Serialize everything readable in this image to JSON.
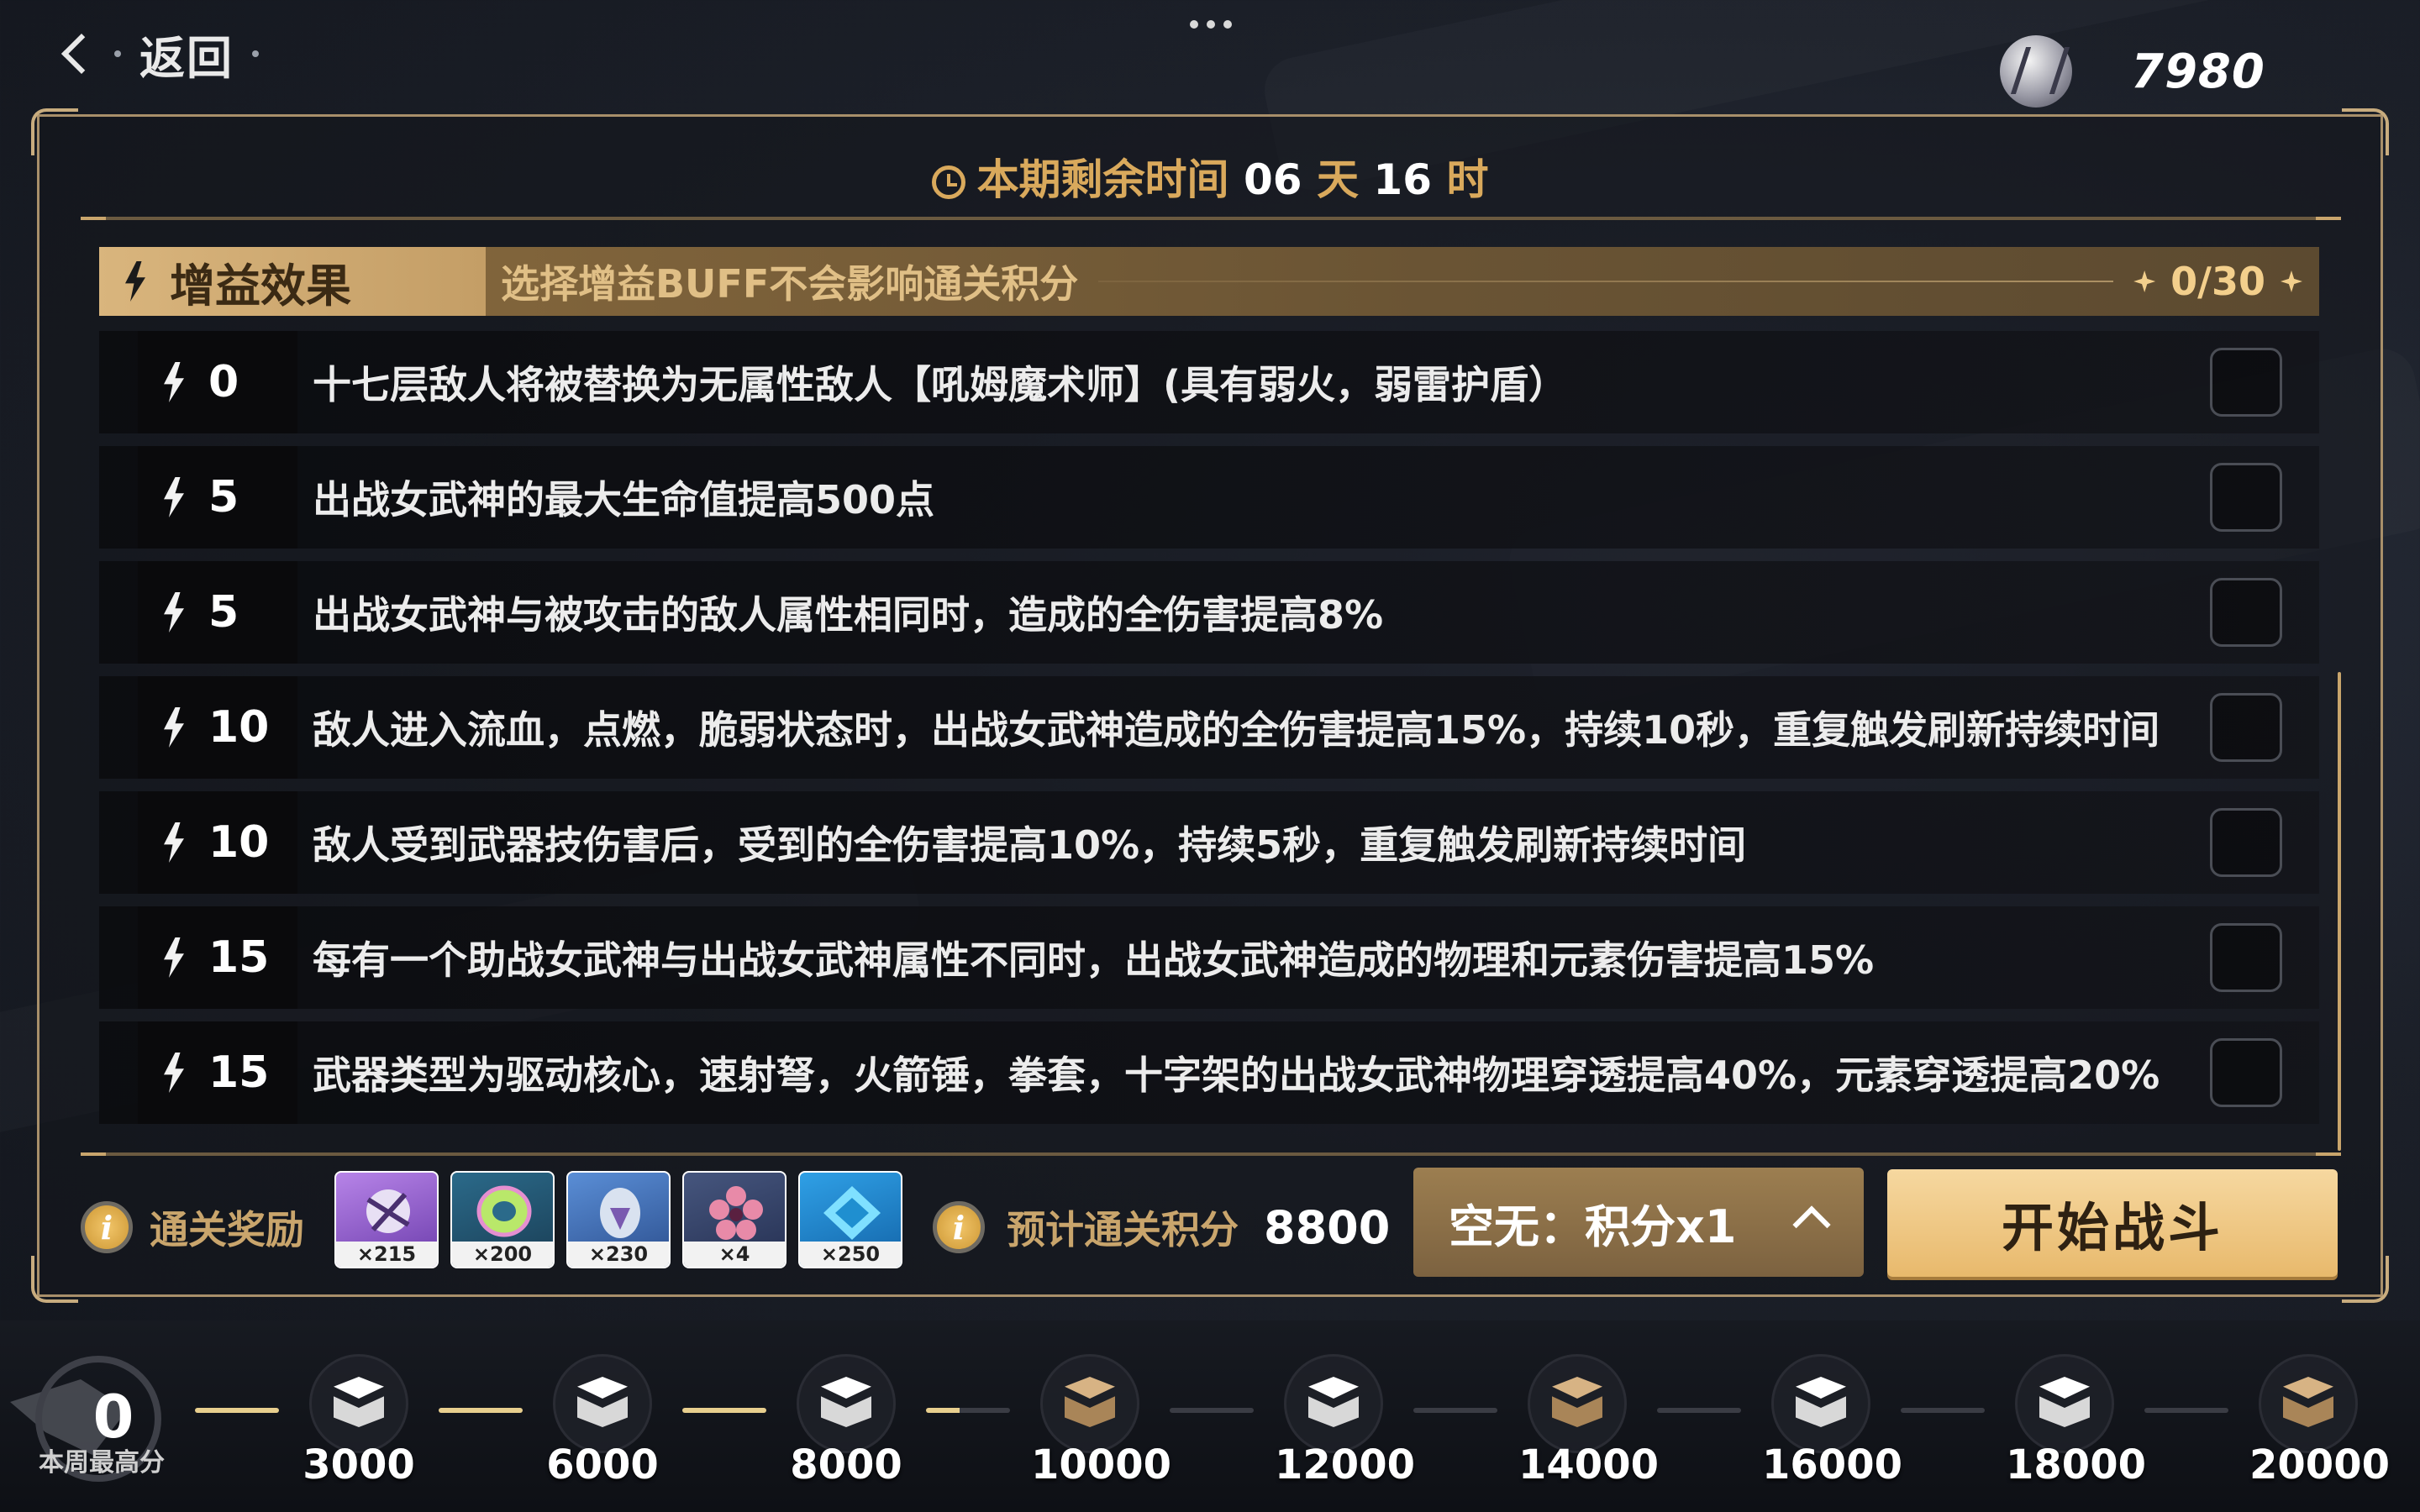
{
  "topbar": {
    "back_label": "返回",
    "currency_value": "7980"
  },
  "timer": {
    "label": "本期剩余时间",
    "days": "06",
    "days_unit": "天",
    "hours": "16",
    "hours_unit": "时"
  },
  "buff_header": {
    "title": "增益效果",
    "note": "选择增益BUFF不会影响通关积分",
    "count": "0/30"
  },
  "buffs": [
    {
      "cost": "0",
      "desc": "十七层敌人将被替换为无属性敌人【吼姆魔术师】(具有弱火，弱雷护盾）",
      "checked": false
    },
    {
      "cost": "5",
      "desc": "出战女武神的最大生命值提高500点",
      "checked": false
    },
    {
      "cost": "5",
      "desc": "出战女武神与被攻击的敌人属性相同时，造成的全伤害提高8%",
      "checked": false
    },
    {
      "cost": "10",
      "desc": "敌人进入流血，点燃，脆弱状态时，出战女武神造成的全伤害提高15%，持续10秒，重复触发刷新持续时间",
      "checked": false
    },
    {
      "cost": "10",
      "desc": "敌人受到武器技伤害后，受到的全伤害提高10%，持续5秒，重复触发刷新持续时间",
      "checked": false
    },
    {
      "cost": "15",
      "desc": "每有一个助战女武神与出战女武神属性不同时，出战女武神造成的物理和元素伤害提高15%",
      "checked": false
    },
    {
      "cost": "15",
      "desc": "武器类型为驱动核心，速射弩，火箭锤，拳套，十字架的出战女武神物理穿透提高40%，元素穿透提高20%",
      "checked": false
    }
  ],
  "rewards": {
    "label": "通关奖励",
    "items": [
      {
        "icon": "valkyrie-fragment-icon",
        "qty": "×215"
      },
      {
        "icon": "coin-icon",
        "qty": "×200"
      },
      {
        "icon": "egg-crystal-icon",
        "qty": "×230"
      },
      {
        "icon": "pink-flower-icon",
        "qty": "×4"
      },
      {
        "icon": "blue-crystal-icon",
        "qty": "×250"
      }
    ]
  },
  "score": {
    "label": "预计通关积分",
    "value": "8800"
  },
  "mode": {
    "label": "空无：积分x1"
  },
  "start_button": "开始战斗",
  "progress": {
    "best_score": "0",
    "best_label": "本周最高分",
    "milestones": [
      {
        "value": "3000",
        "color": "white"
      },
      {
        "value": "6000",
        "color": "white"
      },
      {
        "value": "8000",
        "color": "white"
      },
      {
        "value": "10000",
        "color": "brown"
      },
      {
        "value": "12000",
        "color": "white"
      },
      {
        "value": "14000",
        "color": "brown"
      },
      {
        "value": "16000",
        "color": "white"
      },
      {
        "value": "18000",
        "color": "white"
      },
      {
        "value": "20000",
        "color": "brown"
      }
    ]
  },
  "colors": {
    "accent_gold": "#c9a56c",
    "button_gold": "#f6d8a0",
    "timer_gold": "#d9a95c"
  }
}
